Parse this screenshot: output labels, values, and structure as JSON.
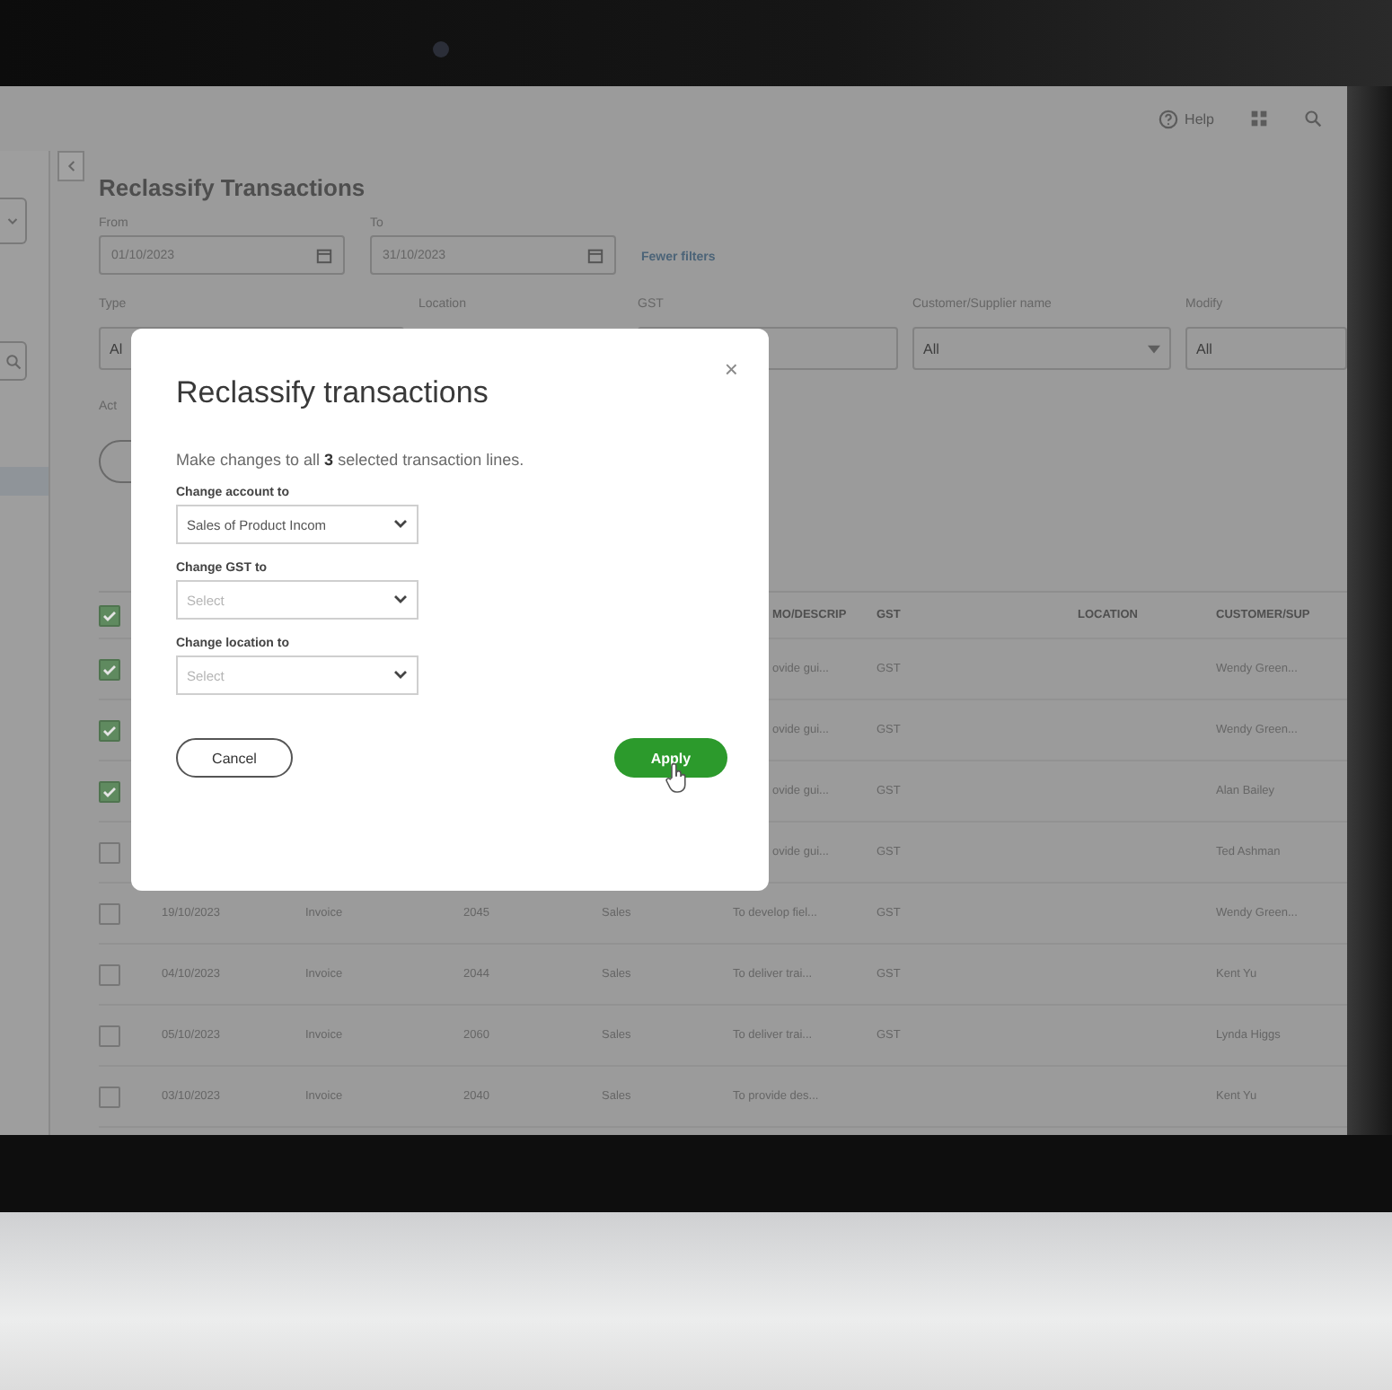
{
  "topbar": {
    "help": "Help"
  },
  "page": {
    "title": "Reclassify Transactions",
    "from_label": "From",
    "from_date": "01/10/2023",
    "to_label": "To",
    "to_date": "31/10/2023",
    "filters_link": "Fewer filters"
  },
  "filters": [
    {
      "kind": "select",
      "label": "Type",
      "value": "Al"
    },
    {
      "kind": "label",
      "label": "Location"
    },
    {
      "kind": "empty-select",
      "label": "GST"
    },
    {
      "kind": "select",
      "label": "Customer/Supplier name",
      "value": "All"
    },
    {
      "kind": "select",
      "label": "Modify",
      "value": "All"
    }
  ],
  "action_label": "Act",
  "table": {
    "header_checked": true,
    "columns": [
      "MO/DESCRIP",
      "GST",
      "LOCATION",
      "CUSTOMER/SUP"
    ],
    "rows": [
      {
        "checked": true,
        "memo": "ovide gui...",
        "gst": "GST",
        "customer": "Wendy Green..."
      },
      {
        "checked": true,
        "memo": "ovide gui...",
        "gst": "GST",
        "customer": "Wendy Green..."
      },
      {
        "checked": true,
        "memo": "ovide gui...",
        "gst": "GST",
        "customer": "Alan Bailey"
      },
      {
        "checked": false,
        "memo": "ovide gui...",
        "gst": "GST",
        "customer": "Ted Ashman"
      },
      {
        "checked": false,
        "date": "19/10/2023",
        "type": "Invoice",
        "num": "2045",
        "account": "Sales",
        "memo": "To develop fiel...",
        "gst": "GST",
        "customer": "Wendy Green..."
      },
      {
        "checked": false,
        "date": "04/10/2023",
        "type": "Invoice",
        "num": "2044",
        "account": "Sales",
        "memo": "To deliver trai...",
        "gst": "GST",
        "customer": "Kent Yu"
      },
      {
        "checked": false,
        "date": "05/10/2023",
        "type": "Invoice",
        "num": "2060",
        "account": "Sales",
        "memo": "To deliver trai...",
        "gst": "GST",
        "customer": "Lynda Higgs"
      },
      {
        "checked": false,
        "date": "03/10/2023",
        "type": "Invoice",
        "num": "2040",
        "account": "Sales",
        "memo": "To provide des...",
        "customer": "Kent Yu"
      }
    ]
  },
  "dialog": {
    "title": "Reclassify transactions",
    "close": "×",
    "message": "Make changes to all **3** selected transaction lines.",
    "fields": [
      {
        "label": "Change account to",
        "value": "Sales of Product Incom"
      },
      {
        "label": "Change GST to",
        "placeholder": "Select"
      },
      {
        "label": "Change location to",
        "placeholder": "Select"
      }
    ],
    "cancel": "Cancel",
    "apply": "Apply"
  }
}
